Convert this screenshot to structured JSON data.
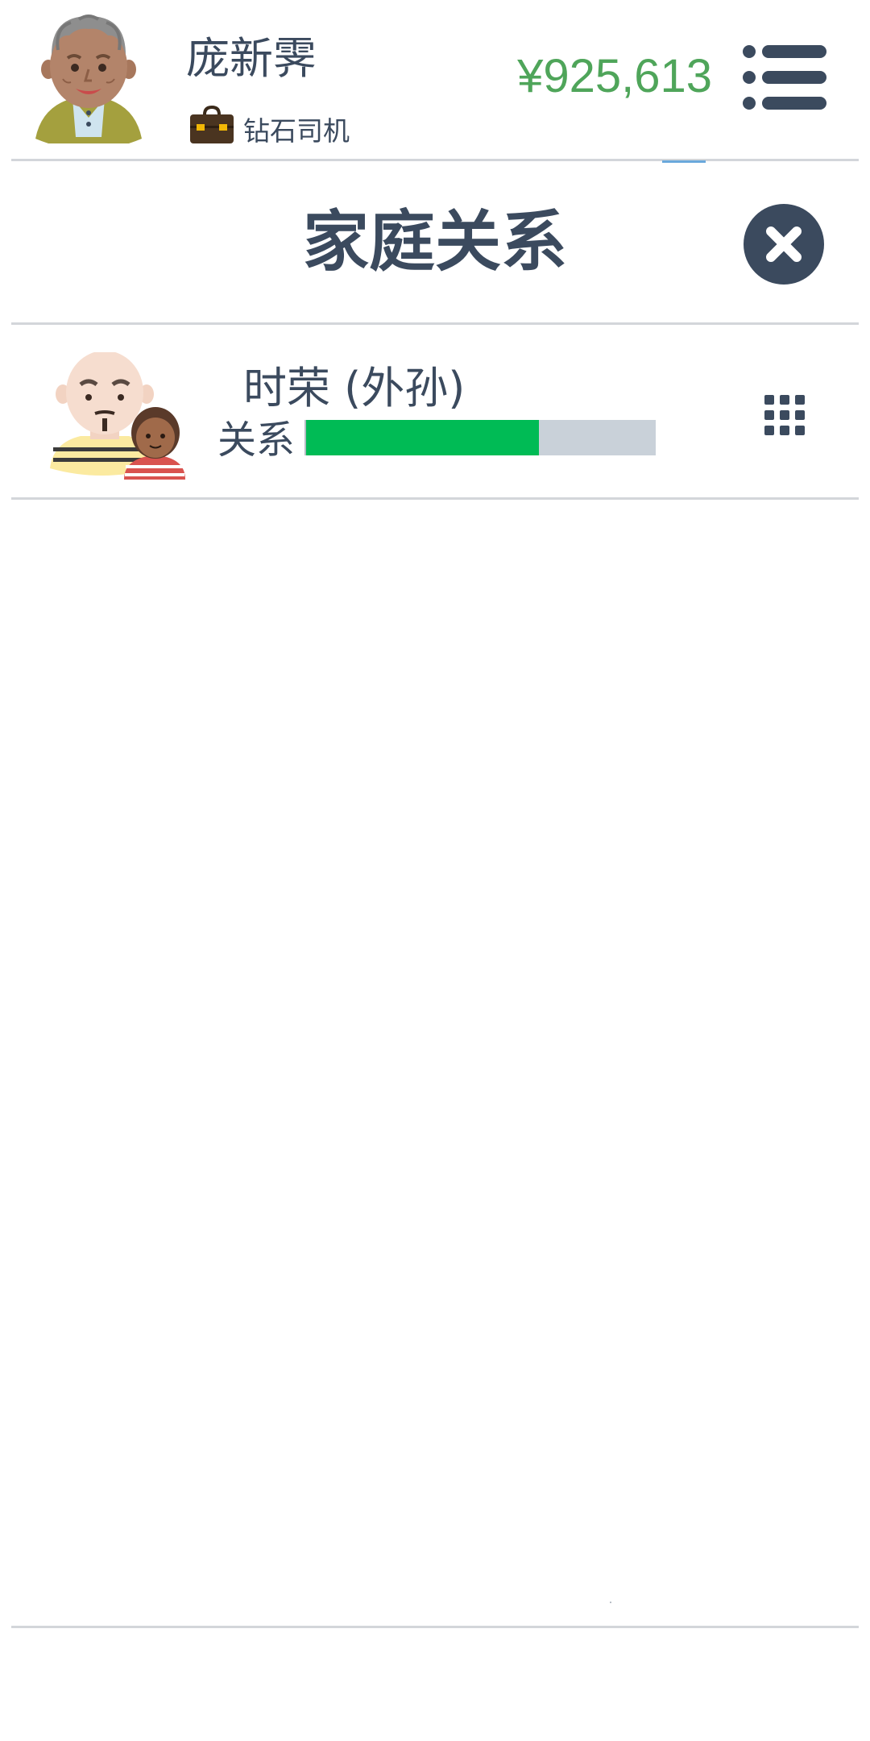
{
  "header": {
    "player_name": "庞新霁",
    "job_title": "钻石司机",
    "money": "¥925,613",
    "icons": {
      "avatar": "elderly-man-avatar-icon",
      "job": "briefcase-icon",
      "menu": "menu-list-icon"
    }
  },
  "panel": {
    "title": "家庭关系",
    "close_icon": "close-icon"
  },
  "relations": [
    {
      "name": "时荣 (外孙)",
      "relation_label": "关系",
      "relation_level": 0.665,
      "avatar_icon": "grandparent-with-child-icon",
      "actions_icon": "grid-actions-icon"
    }
  ],
  "colors": {
    "text": "#3b4a5e",
    "money": "#4fa55a",
    "relation_fill": "#00bb55",
    "relation_track": "#c9d1d9",
    "divider": "#d3d6da",
    "tab_indicator": "#6aa8dc"
  }
}
